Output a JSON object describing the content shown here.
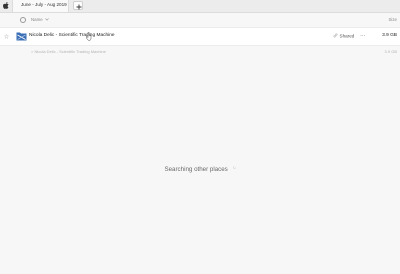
{
  "tabs": [
    {
      "label": "June - July - Aug 2019"
    }
  ],
  "header": {
    "name_label": "Name",
    "size_label": "Size"
  },
  "rows": [
    {
      "name": "Nicola Delic - Scientific Trading Machine",
      "shared_label": "Shared",
      "more_label": "…",
      "size": "3.9 GB"
    }
  ],
  "sub_result": {
    "path_text": "> Nicola Delic - Scientific Trading Machine",
    "size": "3.9 GB"
  },
  "status": {
    "searching_text": "Searching other places"
  },
  "colors": {
    "folder_blue": "#3b6fb6",
    "row_bg": "#ffffff",
    "page_bg": "#f7f7f7"
  },
  "icons": [
    "apple-icon",
    "plus-icon",
    "star-icon",
    "folder-icon",
    "link-icon",
    "more-icon",
    "spinner-icon",
    "cursor-icon",
    "select-all-icon",
    "sort-arrow-icon"
  ]
}
